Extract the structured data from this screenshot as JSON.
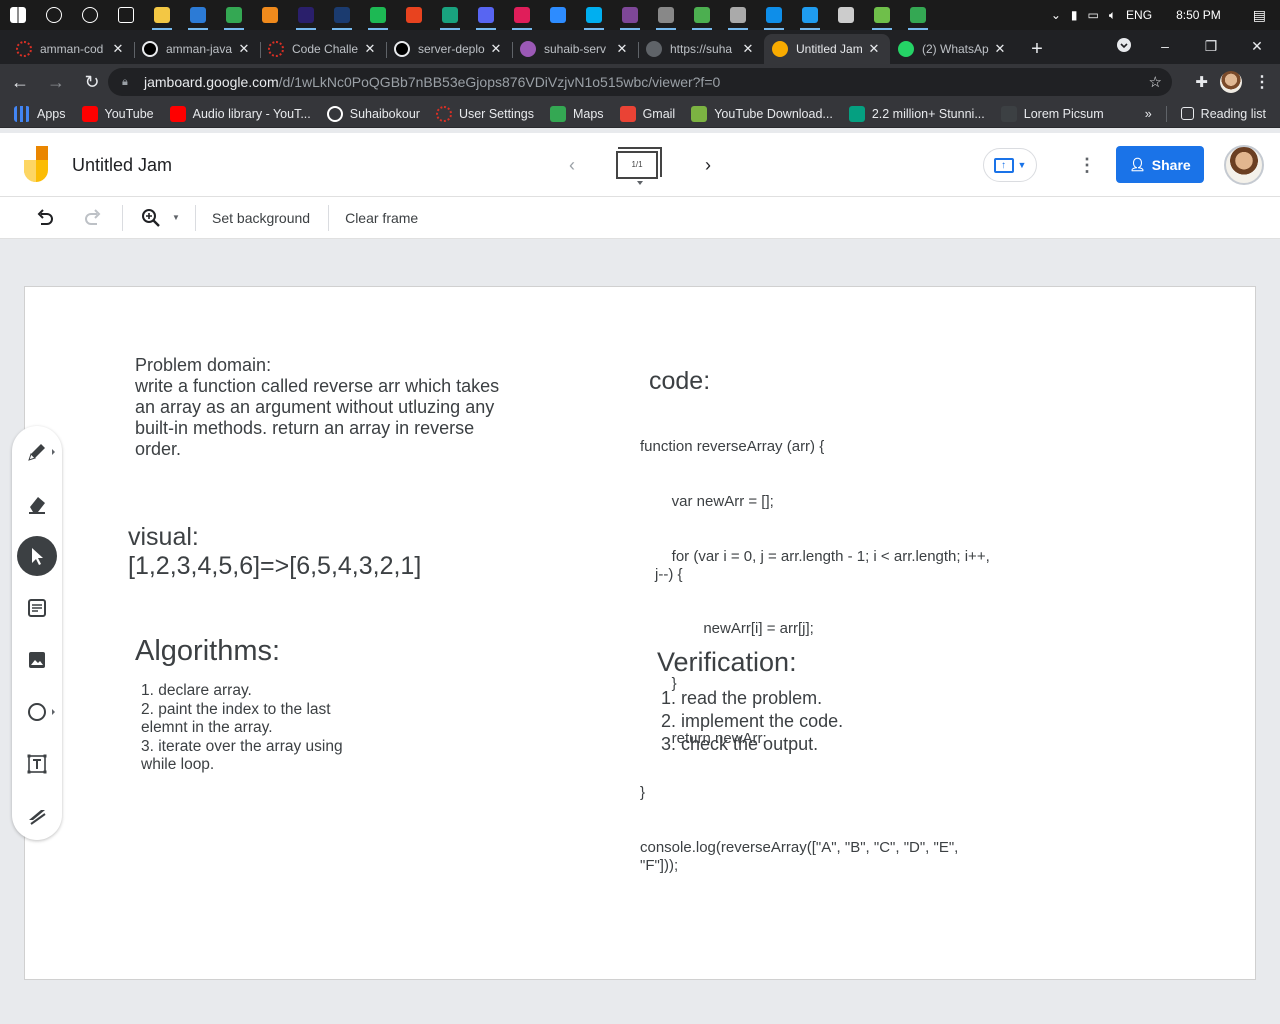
{
  "taskbar": {
    "icons": [
      {
        "name": "windows-start-icon",
        "color": "#ffffff"
      },
      {
        "name": "search-icon",
        "color": "#ffffff"
      },
      {
        "name": "cortana-icon",
        "color": "#ffffff"
      },
      {
        "name": "task-view-icon",
        "color": "#ffffff"
      },
      {
        "name": "file-explorer-icon",
        "color": "#f3c744"
      },
      {
        "name": "mail-icon",
        "color": "#2c7bd6"
      },
      {
        "name": "chrome-icon",
        "color": "#34a853"
      },
      {
        "name": "vlc-icon",
        "color": "#f08a1c"
      },
      {
        "name": "premiere-icon",
        "color": "#2a1f6b"
      },
      {
        "name": "steam-icon",
        "color": "#1b3b6f"
      },
      {
        "name": "spotify-icon",
        "color": "#1db954"
      },
      {
        "name": "office-icon",
        "color": "#e8431f"
      },
      {
        "name": "chatgpt-icon",
        "color": "#19a37f"
      },
      {
        "name": "discord-icon",
        "color": "#5865f2"
      },
      {
        "name": "slack-icon",
        "color": "#e01e5a"
      },
      {
        "name": "zoom-icon",
        "color": "#2d8cff"
      },
      {
        "name": "skype-icon",
        "color": "#00aff0"
      },
      {
        "name": "tor-icon",
        "color": "#7e4798"
      },
      {
        "name": "cursor-app-icon",
        "color": "#888888"
      },
      {
        "name": "photo-app-icon",
        "color": "#4caf50"
      },
      {
        "name": "people-icon",
        "color": "#aaaaaa"
      },
      {
        "name": "teamviewer-icon",
        "color": "#0e8ee9"
      },
      {
        "name": "vscode-icon",
        "color": "#1f9cf0"
      },
      {
        "name": "terminal-icon",
        "color": "#cccccc"
      },
      {
        "name": "git-gui-icon",
        "color": "#6fbf4a"
      },
      {
        "name": "guardian-icon",
        "color": "#34a853"
      }
    ],
    "tray": {
      "lang": "ENG",
      "time": "8:50 PM"
    }
  },
  "tabs": [
    {
      "label": "amman-cod",
      "fav_color": "#d93025",
      "fav_icon": "loading-icon"
    },
    {
      "label": "amman-java",
      "fav_color": "#000000",
      "fav_icon": "github-icon"
    },
    {
      "label": "Code Challe",
      "fav_color": "#d93025",
      "fav_icon": "loading-icon"
    },
    {
      "label": "server-deplo",
      "fav_color": "#000000",
      "fav_icon": "github-icon"
    },
    {
      "label": "suhaib-serv",
      "fav_color": "#9b59b6",
      "fav_icon": "heroku-icon"
    },
    {
      "label": "https://suha",
      "fav_color": "#5f6368",
      "fav_icon": "globe-icon"
    },
    {
      "label": "Untitled Jam",
      "fav_color": "#f9ab00",
      "fav_icon": "jamboard-icon",
      "active": true
    },
    {
      "label": "(2) WhatsAp",
      "fav_color": "#25d366",
      "fav_icon": "whatsapp-icon"
    }
  ],
  "addressbar": {
    "host": "jamboard.google.com",
    "path": "/d/1wLkNc0PoQGBb7nBB53eGjops876VDiVzjvN1o515wbc/viewer?f=0"
  },
  "bookmarks": {
    "items": [
      {
        "label": "Apps",
        "icon": "apps-grid-icon",
        "color": "#4285f4"
      },
      {
        "label": "YouTube",
        "icon": "youtube-icon",
        "color": "#ff0000"
      },
      {
        "label": "Audio library - YouT...",
        "icon": "youtube-icon",
        "color": "#ff0000"
      },
      {
        "label": "Suhaibokour",
        "icon": "github-icon",
        "color": "#ffffff"
      },
      {
        "label": "User Settings",
        "icon": "loading-icon",
        "color": "#d93025"
      },
      {
        "label": "Maps",
        "icon": "maps-icon",
        "color": "#34a853"
      },
      {
        "label": "Gmail",
        "icon": "gmail-icon",
        "color": "#ea4335"
      },
      {
        "label": "YouTube Download...",
        "icon": "download-icon",
        "color": "#7cb342"
      },
      {
        "label": "2.2 million+ Stunni...",
        "icon": "pexels-icon",
        "color": "#05a081"
      },
      {
        "label": "Lorem Picsum",
        "icon": "image-icon",
        "color": "#3c4043"
      }
    ],
    "overflow": "»",
    "reading_list": "Reading list"
  },
  "jam": {
    "title": "Untitled Jam",
    "frame_counter": "1/1",
    "share_label": "Share"
  },
  "toolbar": {
    "set_background": "Set background",
    "clear_frame": "Clear frame"
  },
  "canvas": {
    "problem_heading": "Problem domain:",
    "problem_text": "write a function called reverse arr which takes an array as an argument without utluzing any built-in methods. return an array in reverse order.",
    "visual_heading": "visual:",
    "visual_text": "[1,2,3,4,5,6]=>[6,5,4,3,2,1]",
    "algorithms_heading": "Algorithms:",
    "algorithms": [
      "1. declare array.",
      "2. paint the index to the last elemnt in the array.",
      "3. iterate over the array using while loop."
    ],
    "code_heading": "code:",
    "code_lines": [
      "function reverseArray (arr) {",
      "    var newArr = [];",
      "    for (var i = 0, j = arr.length - 1; i < arr.length; i++, j--) {",
      "        newArr[i] = arr[j];",
      "    }",
      "    return newArr;",
      "}",
      "console.log(reverseArray([\"A\", \"B\", \"C\", \"D\", \"E\", \"F\"]));"
    ],
    "verification_heading": "Verification:",
    "verification": [
      "1. read the problem.",
      "2. implement the code.",
      "3. check the output."
    ]
  },
  "palette": {
    "tools": [
      "pen-icon",
      "eraser-icon",
      "select-icon",
      "sticky-note-icon",
      "image-icon",
      "circle-shape-icon",
      "text-box-icon",
      "laser-icon"
    ],
    "selected": "select-icon"
  },
  "colors": {
    "accent": "#1a73e8",
    "chrome_dark": "#202124",
    "chrome_tab": "#35363a",
    "jam_yellow": "#f9ab00"
  }
}
